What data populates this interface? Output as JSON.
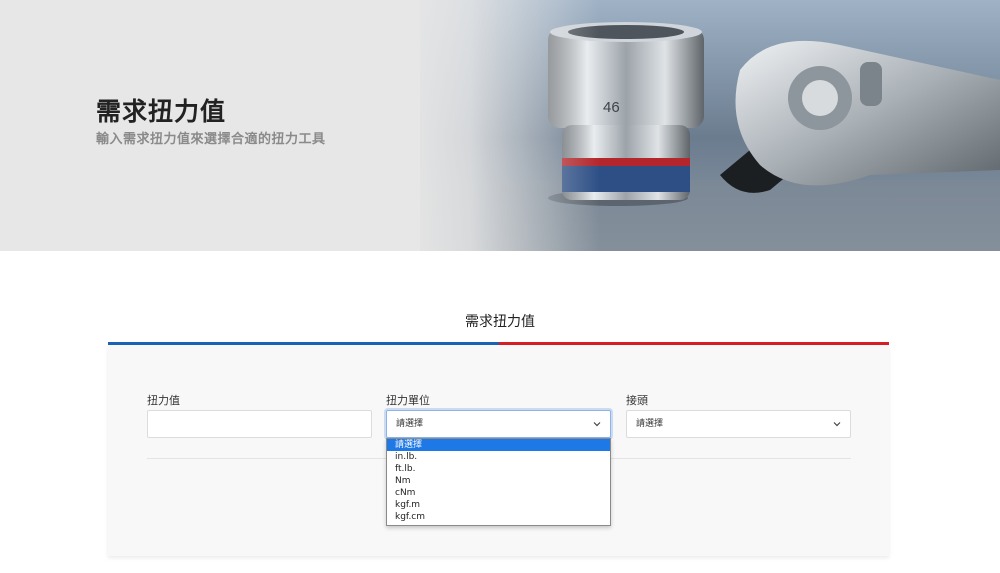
{
  "hero": {
    "title": "需求扭力值",
    "subtitle": "輸入需求扭力值來選擇合適的扭力工具",
    "socket_marking": "46"
  },
  "section": {
    "title": "需求扭力值"
  },
  "form": {
    "torque": {
      "label": "扭力值",
      "value": ""
    },
    "unit": {
      "label": "扭力單位",
      "selected": "請選擇",
      "options": [
        "請選擇",
        "in.lb.",
        "ft.lb.",
        "Nm",
        "cNm",
        "kgf.m",
        "kgf.cm"
      ]
    },
    "connector": {
      "label": "接頭",
      "selected": "請選擇"
    }
  },
  "colors": {
    "blue_accent": "#1d63b4",
    "red_accent": "#d61f26",
    "highlight": "#1e78e6"
  },
  "icons": {
    "unit_select": "chevron-down-icon",
    "connector_select": "chevron-down-icon"
  }
}
